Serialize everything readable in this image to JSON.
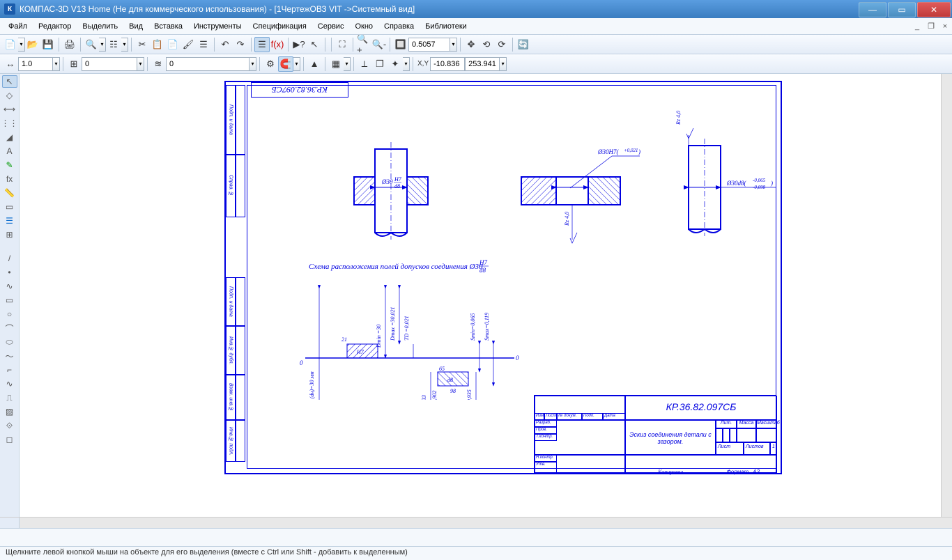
{
  "title": "КОМПАС-3D V13 Home (Не для коммерческого использования) - [1ЧертежОВЗ VIT ->Системный вид]",
  "menu": [
    "Файл",
    "Редактор",
    "Выделить",
    "Вид",
    "Вставка",
    "Инструменты",
    "Спецификация",
    "Сервис",
    "Окно",
    "Справка",
    "Библиотеки"
  ],
  "toolbar2": {
    "zoom_value": "0.5057"
  },
  "toolbar3": {
    "val1": "1.0",
    "val2": "0",
    "val3": "0",
    "coord_x": "-10.836",
    "coord_y": "253.941"
  },
  "statusbar": "Щелкните левой кнопкой мыши на объекте для его выделения (вместе с Ctrl или Shift - добавить к выделенным)",
  "drawing": {
    "corner_label": "КР.36.82.097СБ",
    "caption": "Схема расположения полей допусков соединения Ø30",
    "caption_frac_top": "H7",
    "caption_frac_bot": "d8",
    "dim1_frac_top": "H7",
    "dim1_frac_bot": "d8",
    "dim1_dia": "Ø30",
    "dim2": "Ø30H7(",
    "dim2_sup": "+0,021",
    "dim2_close": ")",
    "dim3": "Ø30d8(",
    "dim3_sup": "-0,065",
    "dim3_sub": "-0,098",
    "dim3_close": ")",
    "rz1": "Rz 4,0",
    "rz2": "Rz 4,0",
    "diag_21": "21",
    "diag_0l": "0",
    "diag_0r": "0",
    "diag_65": "65",
    "diag_98": "98",
    "diag_h7": "H7",
    "diag_d8": "d8",
    "diag_v1": "Dн (dн)=30 мм",
    "diag_v2": "Dmax =30,021",
    "diag_v3": "Dmin =30",
    "diag_v4": "TD =0,021",
    "diag_v5": "Smax=0,119",
    "diag_v6": "Smin=0,065",
    "diag_v7": "dmax=29,935",
    "diag_v8": "dmin=29,902",
    "diag_v9": "Td=0,033",
    "tb_code": "КР.36.82.097СБ",
    "tb_name": "Эскиз соединения детали с зазором.",
    "tb_lit": "Лит.",
    "tb_mass": "Масса",
    "tb_scale": "Масштаб",
    "tb_list": "Лист",
    "tb_lists": "Листов",
    "tb_lists_n": "1",
    "tb_format": "Формат",
    "tb_a3": "A3",
    "tb_copied": "Копировал",
    "tb_izm": "Изм",
    "tb_list2": "Лист",
    "tb_ndoc": "№ докум.",
    "tb_podp": "Подп.",
    "tb_data": "Дата",
    "tb_razrab": "Разраб.",
    "tb_prov": "Пров.",
    "tb_tkontr": "Т.контр.",
    "tb_nkontr": "Н.контр.",
    "tb_utv": "Утв."
  }
}
